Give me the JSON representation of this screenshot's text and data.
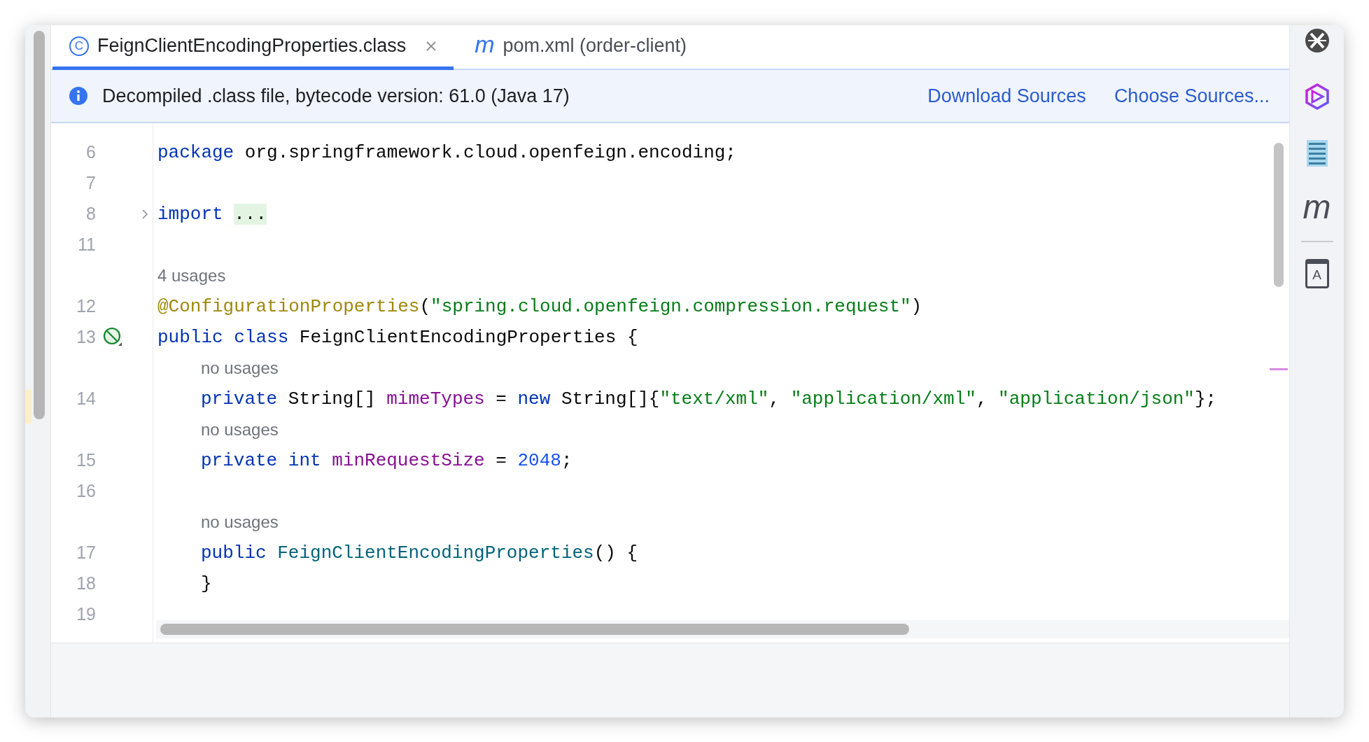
{
  "tabs": [
    {
      "label": "FeignClientEncodingProperties.class",
      "icon_glyph": "C",
      "kind": "class",
      "closable": true,
      "selected": true
    },
    {
      "label": "pom.xml (order-client)",
      "icon_glyph": "m",
      "kind": "maven",
      "closable": false,
      "selected": false
    }
  ],
  "banner": {
    "text": "Decompiled .class file, bytecode version: 61.0 (Java 17)",
    "links": [
      "Download Sources",
      "Choose Sources..."
    ]
  },
  "lines": [
    {
      "kind": "code",
      "number": "6",
      "tokens": [
        {
          "kind": "keyword",
          "s": "package "
        },
        {
          "kind": "plain",
          "s": "org.springframework.cloud.openfeign.encoding;"
        }
      ]
    },
    {
      "kind": "code",
      "number": "7"
    },
    {
      "kind": "code",
      "number": "8",
      "folded": true,
      "tokens": [
        {
          "kind": "keyword",
          "s": "import "
        },
        {
          "kind": "fold",
          "s": "..."
        }
      ]
    },
    {
      "kind": "code",
      "number": "11"
    },
    {
      "kind": "hint",
      "text": "4 usages"
    },
    {
      "kind": "code",
      "number": "12",
      "tokens": [
        {
          "kind": "annotation",
          "s": "@ConfigurationProperties"
        },
        {
          "kind": "plain",
          "s": "("
        },
        {
          "kind": "string",
          "s": "\"spring.cloud.openfeign.compression.request\""
        },
        {
          "kind": "plain",
          "s": ")"
        }
      ]
    },
    {
      "kind": "code",
      "number": "13",
      "marker": true,
      "tokens": [
        {
          "kind": "keyword",
          "s": "public class "
        },
        {
          "kind": "plain",
          "s": "FeignClientEncodingProperties {"
        }
      ],
      "children": [
        {
          "kind": "hint",
          "text": "no usages"
        },
        {
          "kind": "code",
          "number": "14",
          "tokens": [
            {
              "kind": "keyword",
              "s": "private "
            },
            {
              "kind": "plain",
              "s": "String[] "
            },
            {
              "kind": "field",
              "s": "mimeTypes"
            },
            {
              "kind": "plain",
              "s": " = "
            },
            {
              "kind": "keyword",
              "s": "new "
            },
            {
              "kind": "plain",
              "s": "String[]{"
            },
            {
              "kind": "string",
              "s": "\"text/xml\""
            },
            {
              "kind": "plain",
              "s": ", "
            },
            {
              "kind": "string",
              "s": "\"application/xml\""
            },
            {
              "kind": "plain",
              "s": ", "
            },
            {
              "kind": "string",
              "s": "\"application/json\""
            },
            {
              "kind": "plain",
              "s": "};"
            }
          ]
        },
        {
          "kind": "hint",
          "text": "no usages"
        },
        {
          "kind": "code",
          "number": "15",
          "tokens": [
            {
              "kind": "keyword",
              "s": "private int "
            },
            {
              "kind": "field",
              "s": "minRequestSize"
            },
            {
              "kind": "plain",
              "s": " = "
            },
            {
              "kind": "number",
              "s": "2048"
            },
            {
              "kind": "plain",
              "s": ";"
            }
          ]
        },
        {
          "kind": "code",
          "number": "16"
        },
        {
          "kind": "hint",
          "text": "no usages"
        },
        {
          "kind": "code",
          "number": "17",
          "tokens": [
            {
              "kind": "keyword",
              "s": "public "
            },
            {
              "kind": "method",
              "s": "FeignClientEncodingProperties"
            },
            {
              "kind": "plain",
              "s": "() {"
            }
          ]
        },
        {
          "kind": "code",
          "number": "18",
          "tokens": [
            {
              "kind": "plain",
              "s": "}"
            }
          ]
        },
        {
          "kind": "code",
          "number": "19"
        }
      ]
    }
  ],
  "toolbar": [
    {
      "kind": "ai"
    },
    {
      "kind": "hexagon"
    },
    {
      "kind": "binary"
    },
    {
      "kind": "glyph",
      "glyph": "m"
    },
    {
      "kind": "divider"
    },
    {
      "kind": "book",
      "glyph": "A"
    }
  ]
}
